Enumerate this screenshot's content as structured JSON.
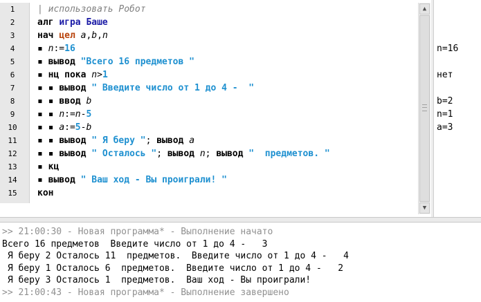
{
  "editor": {
    "line_numbers": [
      "1",
      "2",
      "3",
      "4",
      "5",
      "6",
      "7",
      "8",
      "9",
      "10",
      "11",
      "12",
      "13",
      "14",
      "15"
    ],
    "lines": [
      [
        {
          "t": "| использовать Робот",
          "c": "cmt"
        }
      ],
      [
        {
          "t": "алг ",
          "c": "kw"
        },
        {
          "t": "игра Баше",
          "c": "kwb"
        }
      ],
      [
        {
          "t": "нач ",
          "c": "kw"
        },
        {
          "t": "цел ",
          "c": "typ"
        },
        {
          "t": "a",
          "c": "var"
        },
        {
          "t": ",",
          "c": ""
        },
        {
          "t": "b",
          "c": "var"
        },
        {
          "t": ",",
          "c": ""
        },
        {
          "t": "n",
          "c": "var"
        }
      ],
      [
        {
          "t": "▪ ",
          "c": "bul"
        },
        {
          "t": "n",
          "c": "var"
        },
        {
          "t": ":=",
          "c": ""
        },
        {
          "t": "16",
          "c": "num"
        }
      ],
      [
        {
          "t": "▪ ",
          "c": "bul"
        },
        {
          "t": "вывод ",
          "c": "kw"
        },
        {
          "t": "\"Всего 16 предметов \"",
          "c": "str"
        }
      ],
      [
        {
          "t": "▪ ",
          "c": "bul"
        },
        {
          "t": "нц пока ",
          "c": "kw"
        },
        {
          "t": "n",
          "c": "var"
        },
        {
          "t": ">",
          "c": ""
        },
        {
          "t": "1",
          "c": "num"
        }
      ],
      [
        {
          "t": "▪ ▪ ",
          "c": "bul"
        },
        {
          "t": "вывод ",
          "c": "kw"
        },
        {
          "t": "\" Введите число от 1 до 4 -  \"",
          "c": "str"
        }
      ],
      [
        {
          "t": "▪ ▪ ",
          "c": "bul"
        },
        {
          "t": "ввод ",
          "c": "kw"
        },
        {
          "t": "b",
          "c": "var"
        }
      ],
      [
        {
          "t": "▪ ▪ ",
          "c": "bul"
        },
        {
          "t": "n",
          "c": "var"
        },
        {
          "t": ":=",
          "c": ""
        },
        {
          "t": "n",
          "c": "var"
        },
        {
          "t": "-",
          "c": ""
        },
        {
          "t": "5",
          "c": "num"
        }
      ],
      [
        {
          "t": "▪ ▪ ",
          "c": "bul"
        },
        {
          "t": "a",
          "c": "var"
        },
        {
          "t": ":=",
          "c": ""
        },
        {
          "t": "5",
          "c": "num"
        },
        {
          "t": "-",
          "c": ""
        },
        {
          "t": "b",
          "c": "var"
        }
      ],
      [
        {
          "t": "▪ ▪ ",
          "c": "bul"
        },
        {
          "t": "вывод ",
          "c": "kw"
        },
        {
          "t": "\" Я беру \"",
          "c": "str"
        },
        {
          "t": "; ",
          "c": ""
        },
        {
          "t": "вывод ",
          "c": "kw"
        },
        {
          "t": "a",
          "c": "var"
        }
      ],
      [
        {
          "t": "▪ ▪ ",
          "c": "bul"
        },
        {
          "t": "вывод ",
          "c": "kw"
        },
        {
          "t": "\" Осталось \"",
          "c": "str"
        },
        {
          "t": "; ",
          "c": ""
        },
        {
          "t": "вывод ",
          "c": "kw"
        },
        {
          "t": "n",
          "c": "var"
        },
        {
          "t": "; ",
          "c": ""
        },
        {
          "t": "вывод ",
          "c": "kw"
        },
        {
          "t": "\"  предметов. \"",
          "c": "str"
        }
      ],
      [
        {
          "t": "▪ ",
          "c": "bul"
        },
        {
          "t": "кц",
          "c": "kw"
        }
      ],
      [
        {
          "t": "▪ ",
          "c": "bul"
        },
        {
          "t": "вывод ",
          "c": "kw"
        },
        {
          "t": "\" Ваш ход - Вы проиграли! \"",
          "c": "str"
        }
      ],
      [
        {
          "t": "кон",
          "c": "kw"
        }
      ]
    ]
  },
  "values_panel": [
    "",
    "",
    "",
    "n=16",
    "",
    "нет",
    "",
    "b=2",
    "n=1",
    "a=3",
    "",
    "",
    "",
    "",
    ""
  ],
  "scrollbar": {
    "up_icon": "▲",
    "down_icon": "▼"
  },
  "console": {
    "lines": [
      {
        "text": ">> 21:00:30 - Новая программа* - Выполнение начато",
        "grey": true
      },
      {
        "text": "Всего 16 предметов  Введите число от 1 до 4 -   3",
        "grey": false
      },
      {
        "text": " Я беру 2 Осталось 11  предметов.  Введите число от 1 до 4 -   4",
        "grey": false
      },
      {
        "text": " Я беру 1 Осталось 6  предметов.  Введите число от 1 до 4 -   2",
        "grey": false
      },
      {
        "text": " Я беру 3 Осталось 1  предметов.  Ваш ход - Вы проиграли!",
        "grey": false
      },
      {
        "text": ">> 21:00:43 - Новая программа* - Выполнение завершено",
        "grey": true
      }
    ]
  }
}
